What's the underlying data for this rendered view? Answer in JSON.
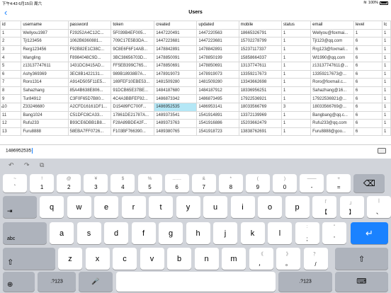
{
  "status": {
    "time": "下午4:43",
    "date": "6月15日 周六",
    "battery": "100%"
  },
  "nav": {
    "back_glyph": "‹",
    "title": "Users"
  },
  "table": {
    "headers": [
      "id",
      "username",
      "password",
      "token",
      "created",
      "updated",
      "mobile",
      "status",
      "email",
      "level",
      "lc"
    ],
    "rows": [
      [
        "1",
        "Wellyou1987",
        "F29252A4C12C...",
        "5F039B4EF005...",
        "1447220491",
        "1447220563",
        "18665326791",
        "1",
        "Wellyou@foxmai...",
        "1",
        "1"
      ],
      [
        "2",
        "Tjl123456",
        "1062B6360881...",
        "709C17E5B3DA...",
        "1447223681",
        "1447223681",
        "15702278799",
        "1",
        "Tjl123@qq.com",
        "6",
        "1"
      ],
      [
        "3",
        "Rerg123456",
        "F92B82E1C38C...",
        "9C8E6F6F14AB...",
        "1478842891",
        "1478842891",
        "15237117337",
        "1",
        "Rrg123@foxmail...",
        "6",
        "1"
      ],
      [
        "4",
        "Wangling",
        "F8984048C9D...",
        "3BC38656703D...",
        "1478850091",
        "1478850199",
        "15858664337",
        "1",
        "Wl1990@qq.com",
        "6",
        "1"
      ],
      [
        "5",
        "z13137747611",
        "1431DC8415AD...",
        "FF5EB399C765...",
        "1478850691",
        "1478850691",
        "13137747611",
        "1",
        "z13137747611@...",
        "6",
        "1"
      ],
      [
        "6",
        "Ashy369369",
        "3EC8B1422131...",
        "989B18938B7A...",
        "1478919073",
        "1478919073",
        "13359217673",
        "1",
        "13359217673@...",
        "6",
        "1"
      ],
      [
        "7",
        "Roro1314",
        "A914D505F11E5...",
        "169FEF10EBE53...",
        "1481509280",
        "1481509280",
        "13343662698",
        "1",
        "Roro@foxmail.c...",
        "6",
        "1"
      ],
      [
        "8",
        "Sahazhang",
        "85A4B638E806...",
        "91DCB65E37BE...",
        "1484187680",
        "1484187912",
        "18336956251",
        "1",
        "Sahazhang@16...",
        "6",
        "1"
      ],
      [
        "9",
        "Tur84912",
        "C3F0F65D7B80...",
        "4C4A3BBFEF92...",
        "1486873342",
        "1486873495",
        "17922536921",
        "1",
        "17922536921@...",
        "6",
        "1"
      ],
      [
        "10",
        "Z33246680",
        "A2CFD16161DF1...",
        "D15489FC700F...",
        "1486952535",
        "1486953141",
        "18033566769",
        "3",
        "18033566769@...",
        "6",
        "1"
      ],
      [
        "11",
        "Bang1024",
        "C51DFC8CA33...",
        "17861DE21787A...",
        "1489373541",
        "1541914891",
        "13372139969",
        "1",
        "Bangbang@qq.c...",
        "6",
        "1"
      ],
      [
        "12",
        "Rufu233",
        "B93CE6DBB1B8...",
        "F28A89BDE42F...",
        "1489373763",
        "1541916886",
        "15203662479",
        "1",
        "Rufu233@qq.com",
        "6",
        "1"
      ],
      [
        "13",
        "Furu8888",
        "58EBA7FF0726...",
        "F103BF766390...",
        "1489380765",
        "1541918723",
        "13838762691",
        "1",
        "Furu8888@goo...",
        "6",
        "1"
      ]
    ],
    "selected_row_index": 9,
    "selected_col_index": 4,
    "row_marker": "▸"
  },
  "input": {
    "value": "1486952535"
  },
  "keyboard": {
    "shortcuts": {
      "undo": "↶",
      "redo": "↷",
      "paste": "⧉"
    },
    "row1": [
      {
        "top": "~",
        "bottom": "`"
      },
      {
        "top": "!",
        "bottom": "1"
      },
      {
        "top": "@",
        "bottom": "2"
      },
      {
        "top": "¥",
        "bottom": "3"
      },
      {
        "top": "$",
        "bottom": "4"
      },
      {
        "top": "%",
        "bottom": "5"
      },
      {
        "top": "……",
        "bottom": "6"
      },
      {
        "top": "&",
        "bottom": "7"
      },
      {
        "top": "*",
        "bottom": "8"
      },
      {
        "top": "(",
        "bottom": "9"
      },
      {
        "top": ")",
        "bottom": "0"
      },
      {
        "top": "——",
        "bottom": "-"
      },
      {
        "top": "+",
        "bottom": "="
      }
    ],
    "delete_glyph": "⌫",
    "tab_glyph": "⇥",
    "row2": [
      {
        "main": "q"
      },
      {
        "main": "w"
      },
      {
        "main": "e"
      },
      {
        "main": "r"
      },
      {
        "main": "t"
      },
      {
        "main": "y"
      },
      {
        "main": "u"
      },
      {
        "main": "i"
      },
      {
        "main": "o"
      },
      {
        "main": "p"
      },
      {
        "top": "「",
        "bottom": "【"
      },
      {
        "top": "」",
        "bottom": "】"
      },
      {
        "top": "|",
        "bottom": "、"
      }
    ],
    "abc_label": "abc",
    "row3": [
      {
        "main": "a"
      },
      {
        "main": "s"
      },
      {
        "main": "d"
      },
      {
        "main": "f"
      },
      {
        "main": "g"
      },
      {
        "main": "h"
      },
      {
        "main": "j"
      },
      {
        "main": "k"
      },
      {
        "main": "l"
      },
      {
        "top": ":",
        "bottom": ";"
      },
      {
        "top": "\"",
        "bottom": "'"
      }
    ],
    "return_glyph": "↵",
    "shift_glyph": "⇧",
    "row4": [
      {
        "main": "z"
      },
      {
        "main": "x"
      },
      {
        "main": "c"
      },
      {
        "main": "v"
      },
      {
        "main": "b"
      },
      {
        "main": "n"
      },
      {
        "main": "m"
      },
      {
        "top": "《",
        "bottom": "，"
      },
      {
        "top": "》",
        "bottom": "。"
      },
      {
        "top": "？",
        "bottom": "/"
      }
    ],
    "globe_glyph": "⊕",
    "num_label": ".?123",
    "mic_glyph": "🎤",
    "space_label": "",
    "hide_glyph": "⌨"
  }
}
